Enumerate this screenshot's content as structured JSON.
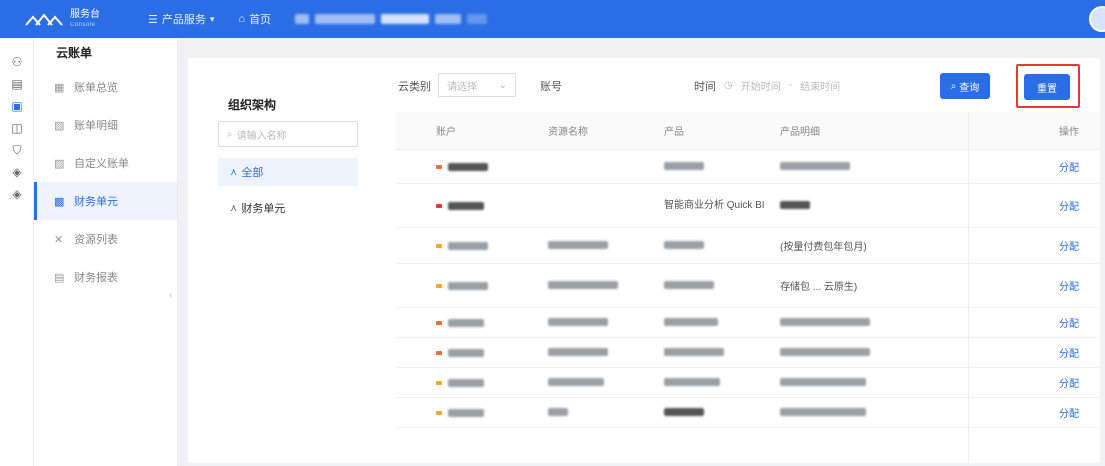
{
  "topbar": {
    "logo_title": "服务台",
    "logo_sub": "Console",
    "nav": [
      {
        "icon": "grid-icon",
        "label": "产品服务",
        "caret": "▾"
      },
      {
        "icon": "home-icon",
        "label": "首页"
      }
    ]
  },
  "sidebar": {
    "title": "云账单",
    "items": [
      {
        "icon": "list-icon",
        "label": "账单总览"
      },
      {
        "icon": "detail-icon",
        "label": "账单明细"
      },
      {
        "icon": "custom-icon",
        "label": "自定义账单"
      },
      {
        "icon": "finance-unit-icon",
        "label": "财务单元",
        "active": true
      },
      {
        "icon": "resource-icon",
        "label": "资源列表"
      },
      {
        "icon": "report-icon",
        "label": "财务报表"
      }
    ]
  },
  "org": {
    "title": "组织架构",
    "search_placeholder": "请输入名称",
    "nodes": [
      {
        "label": "全部",
        "active": true
      },
      {
        "label": "财务单元"
      }
    ]
  },
  "filters": {
    "cloud_label": "云类别",
    "cloud_placeholder": "请选择",
    "account_label": "账号",
    "time_label": "时间",
    "start_placeholder": "开始时间",
    "separator": "-",
    "end_placeholder": "结束时间",
    "query_label": "查询",
    "reset_label": "重置"
  },
  "table": {
    "headers": [
      "账户",
      "资源名称",
      "产品",
      "产品明细",
      "操作"
    ],
    "action_label": "分配",
    "rows": [
      {
        "product": "",
        "detail": "",
        "color": "#f26b3a"
      },
      {
        "product": "智能商业分析 Quick BI",
        "detail": "",
        "color": "#e53935"
      },
      {
        "product": "",
        "detail": "(按量付费包年包月)",
        "color": "#f5a623"
      },
      {
        "product": "",
        "detail": "存储包 ... 云原生)",
        "color": "#f5a623"
      },
      {
        "product": "",
        "detail": "",
        "color": "#f26b3a"
      },
      {
        "product": "",
        "detail": "",
        "color": "#f26b3a"
      },
      {
        "product": "",
        "detail": "",
        "color": "#f5a623"
      },
      {
        "product": "",
        "detail": "",
        "color": "#f5a623"
      }
    ]
  },
  "colors": {
    "brand": "#2b6de5",
    "highlight": "#e53935"
  }
}
